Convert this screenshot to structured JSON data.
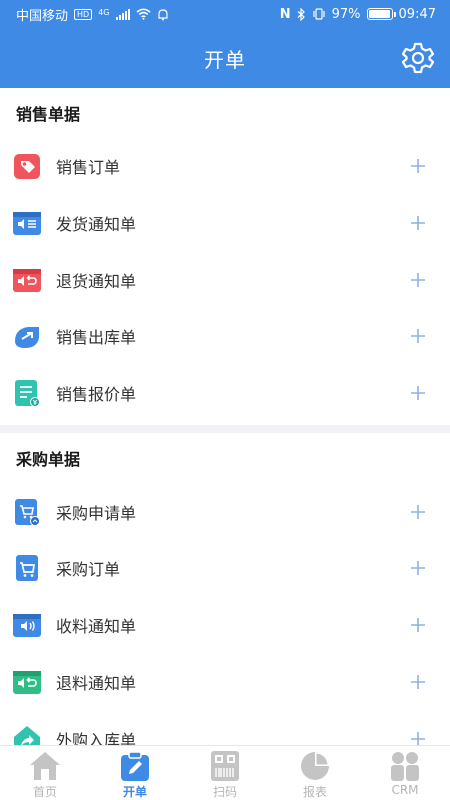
{
  "status_bar": {
    "carrier": "中国移动",
    "hd_badge": "HD",
    "network": "4G",
    "nfc": "N",
    "battery_text": "97%",
    "battery_level": 0.97,
    "time": "09:47"
  },
  "header": {
    "title": "开单",
    "settings_icon": "gear-icon"
  },
  "sections": [
    {
      "title": "销售单据",
      "items": [
        {
          "label": "销售订单",
          "icon": "sales-order-icon",
          "color": "#f0545c"
        },
        {
          "label": "发货通知单",
          "icon": "shipping-notice-icon",
          "color": "#3f8ae4"
        },
        {
          "label": "退货通知单",
          "icon": "return-notice-icon",
          "color": "#f0545c"
        },
        {
          "label": "销售出库单",
          "icon": "sales-outbound-icon",
          "color": "#3f8ae4"
        },
        {
          "label": "销售报价单",
          "icon": "sales-quote-icon",
          "color": "#2fc3b0"
        }
      ]
    },
    {
      "title": "采购单据",
      "items": [
        {
          "label": "采购申请单",
          "icon": "purchase-request-icon",
          "color": "#3f8ae4"
        },
        {
          "label": "采购订单",
          "icon": "purchase-order-icon",
          "color": "#3f8ae4"
        },
        {
          "label": "收料通知单",
          "icon": "receiving-notice-icon",
          "color": "#3f8ae4"
        },
        {
          "label": "退料通知单",
          "icon": "material-return-icon",
          "color": "#2fbf86"
        },
        {
          "label": "外购入库单",
          "icon": "purchase-inbound-icon",
          "color": "#2fc3b0"
        }
      ]
    }
  ],
  "tabs": [
    {
      "label": "首页",
      "icon": "home-icon",
      "active": false
    },
    {
      "label": "开单",
      "icon": "create-order-icon",
      "active": true
    },
    {
      "label": "扫码",
      "icon": "scan-icon",
      "active": false
    },
    {
      "label": "报表",
      "icon": "report-icon",
      "active": false
    },
    {
      "label": "CRM",
      "icon": "crm-icon",
      "active": false
    }
  ],
  "colors": {
    "primary": "#3f8ae4",
    "tab_inactive": "#b5b5b5",
    "add_icon": "#8fb3e0"
  }
}
